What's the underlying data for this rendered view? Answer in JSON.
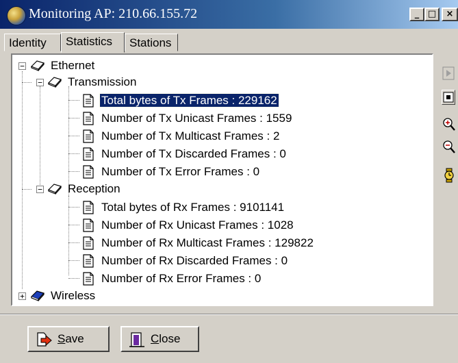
{
  "window": {
    "title": "Monitoring AP: 210.66.155.72",
    "controls": [
      "minimize",
      "maximize",
      "close"
    ]
  },
  "tabs": [
    {
      "label": "Identity",
      "active": false
    },
    {
      "label": "Statistics",
      "active": true
    },
    {
      "label": "Stations",
      "active": false
    }
  ],
  "tree": {
    "ethernet": {
      "label": "Ethernet",
      "expanded": true,
      "transmission": {
        "label": "Transmission",
        "expanded": true,
        "items": [
          {
            "label": "Total bytes of Tx Frames : 229162",
            "selected": true
          },
          {
            "label": "Number of Tx Unicast Frames : 1559",
            "selected": false
          },
          {
            "label": "Number of Tx Multicast Frames : 2",
            "selected": false
          },
          {
            "label": "Number of Tx Discarded Frames : 0",
            "selected": false
          },
          {
            "label": "Number of Tx Error Frames : 0",
            "selected": false
          }
        ]
      },
      "reception": {
        "label": "Reception",
        "expanded": true,
        "items": [
          {
            "label": "Total bytes of Rx Frames : 9101141",
            "selected": false
          },
          {
            "label": "Number of Rx Unicast Frames : 1028",
            "selected": false
          },
          {
            "label": "Number of Rx Multicast Frames : 129822",
            "selected": false
          },
          {
            "label": "Number of Rx Discarded Frames : 0",
            "selected": false
          },
          {
            "label": "Number of Rx Error Frames : 0",
            "selected": false
          }
        ]
      }
    },
    "wireless": {
      "label": "Wireless",
      "expanded": false
    }
  },
  "toolbar": {
    "icons": [
      "play-icon",
      "stop-icon",
      "zoom-in-icon",
      "zoom-out-icon",
      "watch-icon"
    ]
  },
  "buttons": {
    "save": {
      "mnemonic": "S",
      "rest": "ave"
    },
    "close": {
      "mnemonic": "C",
      "rest": "lose"
    }
  },
  "colors": {
    "selection": "#0a246a",
    "title_gradient_start": "#0a246a",
    "title_gradient_end": "#a6caf0",
    "face": "#d4d0c8"
  }
}
